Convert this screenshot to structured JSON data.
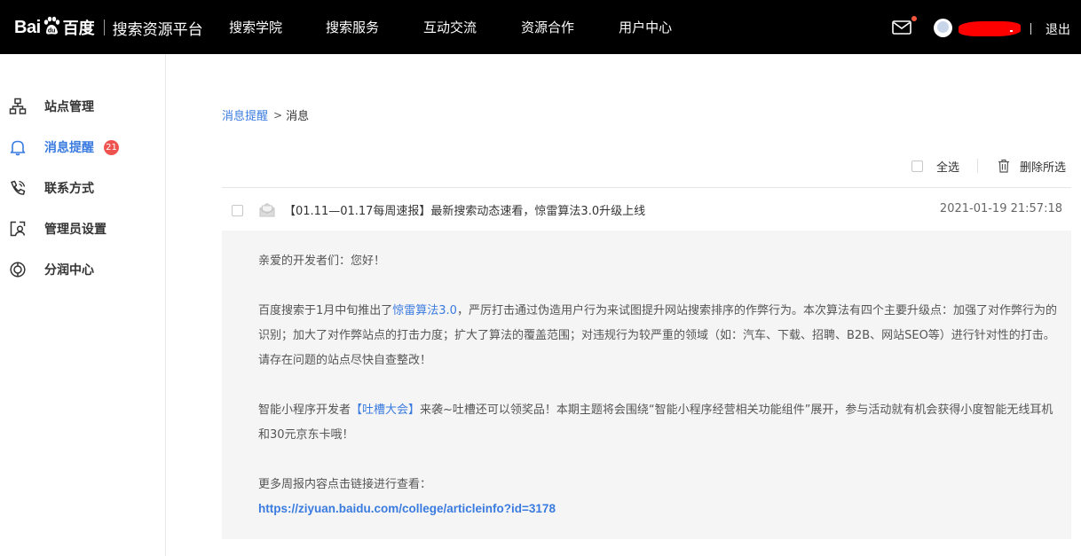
{
  "header": {
    "logo_text": "Bai",
    "logo_text_suffix": "du",
    "logo_cn": "百度",
    "subtitle": "搜索资源平台",
    "nav": [
      "搜索学院",
      "搜索服务",
      "互动交流",
      "资源合作",
      "用户中心"
    ],
    "logout": "退出",
    "icons": {
      "mail": "mail-icon",
      "avatar": "avatar"
    },
    "colors": {
      "background": "#000000",
      "notify_dot": "#f5553b"
    }
  },
  "sidebar": {
    "items": [
      {
        "label": "站点管理",
        "icon": "sitemap-icon"
      },
      {
        "label": "消息提醒",
        "icon": "bell-icon",
        "badge": "21",
        "active": true
      },
      {
        "label": "联系方式",
        "icon": "phone-icon"
      },
      {
        "label": "管理员设置",
        "icon": "admin-icon"
      },
      {
        "label": "分润中心",
        "icon": "revenue-icon"
      }
    ],
    "accent": "#3a7be0"
  },
  "breadcrumb": {
    "parent": "消息提醒",
    "separator": ">",
    "current": "消息"
  },
  "toolbar": {
    "select_all": "全选",
    "delete_selected": "删除所选"
  },
  "message": {
    "title": "【01.11—01.17每周速报】最新搜索动态速看，惊雷算法3.0升级上线",
    "time": "2021-01-19 21:57:18",
    "greeting": "亲爱的开发者们：您好！",
    "p1_before": "百度搜索于1月中旬推出了",
    "p1_link": "惊雷算法3.0",
    "p1_after": "，严厉打击通过伪造用户行为来试图提升网站搜索排序的作弊行为。本次算法有四个主要升级点：加强了对作弊行为的识别；加大了对作弊站点的打击力度；扩大了算法的覆盖范围；对违规行为较严重的领域（如：汽车、下载、招聘、B2B、网站SEO等）进行针对性的打击。请存在问题的站点尽快自查整改！",
    "p2_before": "智能小程序开发者",
    "p2_link": "【吐槽大会】",
    "p2_after": "来袭~吐槽还可以领奖品！本期主题将会围绕“智能小程序经营相关功能组件”展开，参与活动就有机会获得小度智能无线耳机和30元京东卡哦！",
    "p3": "更多周报内容点击链接进行查看：",
    "url": "https://ziyuan.baidu.com/college/articleinfo?id=3178"
  }
}
